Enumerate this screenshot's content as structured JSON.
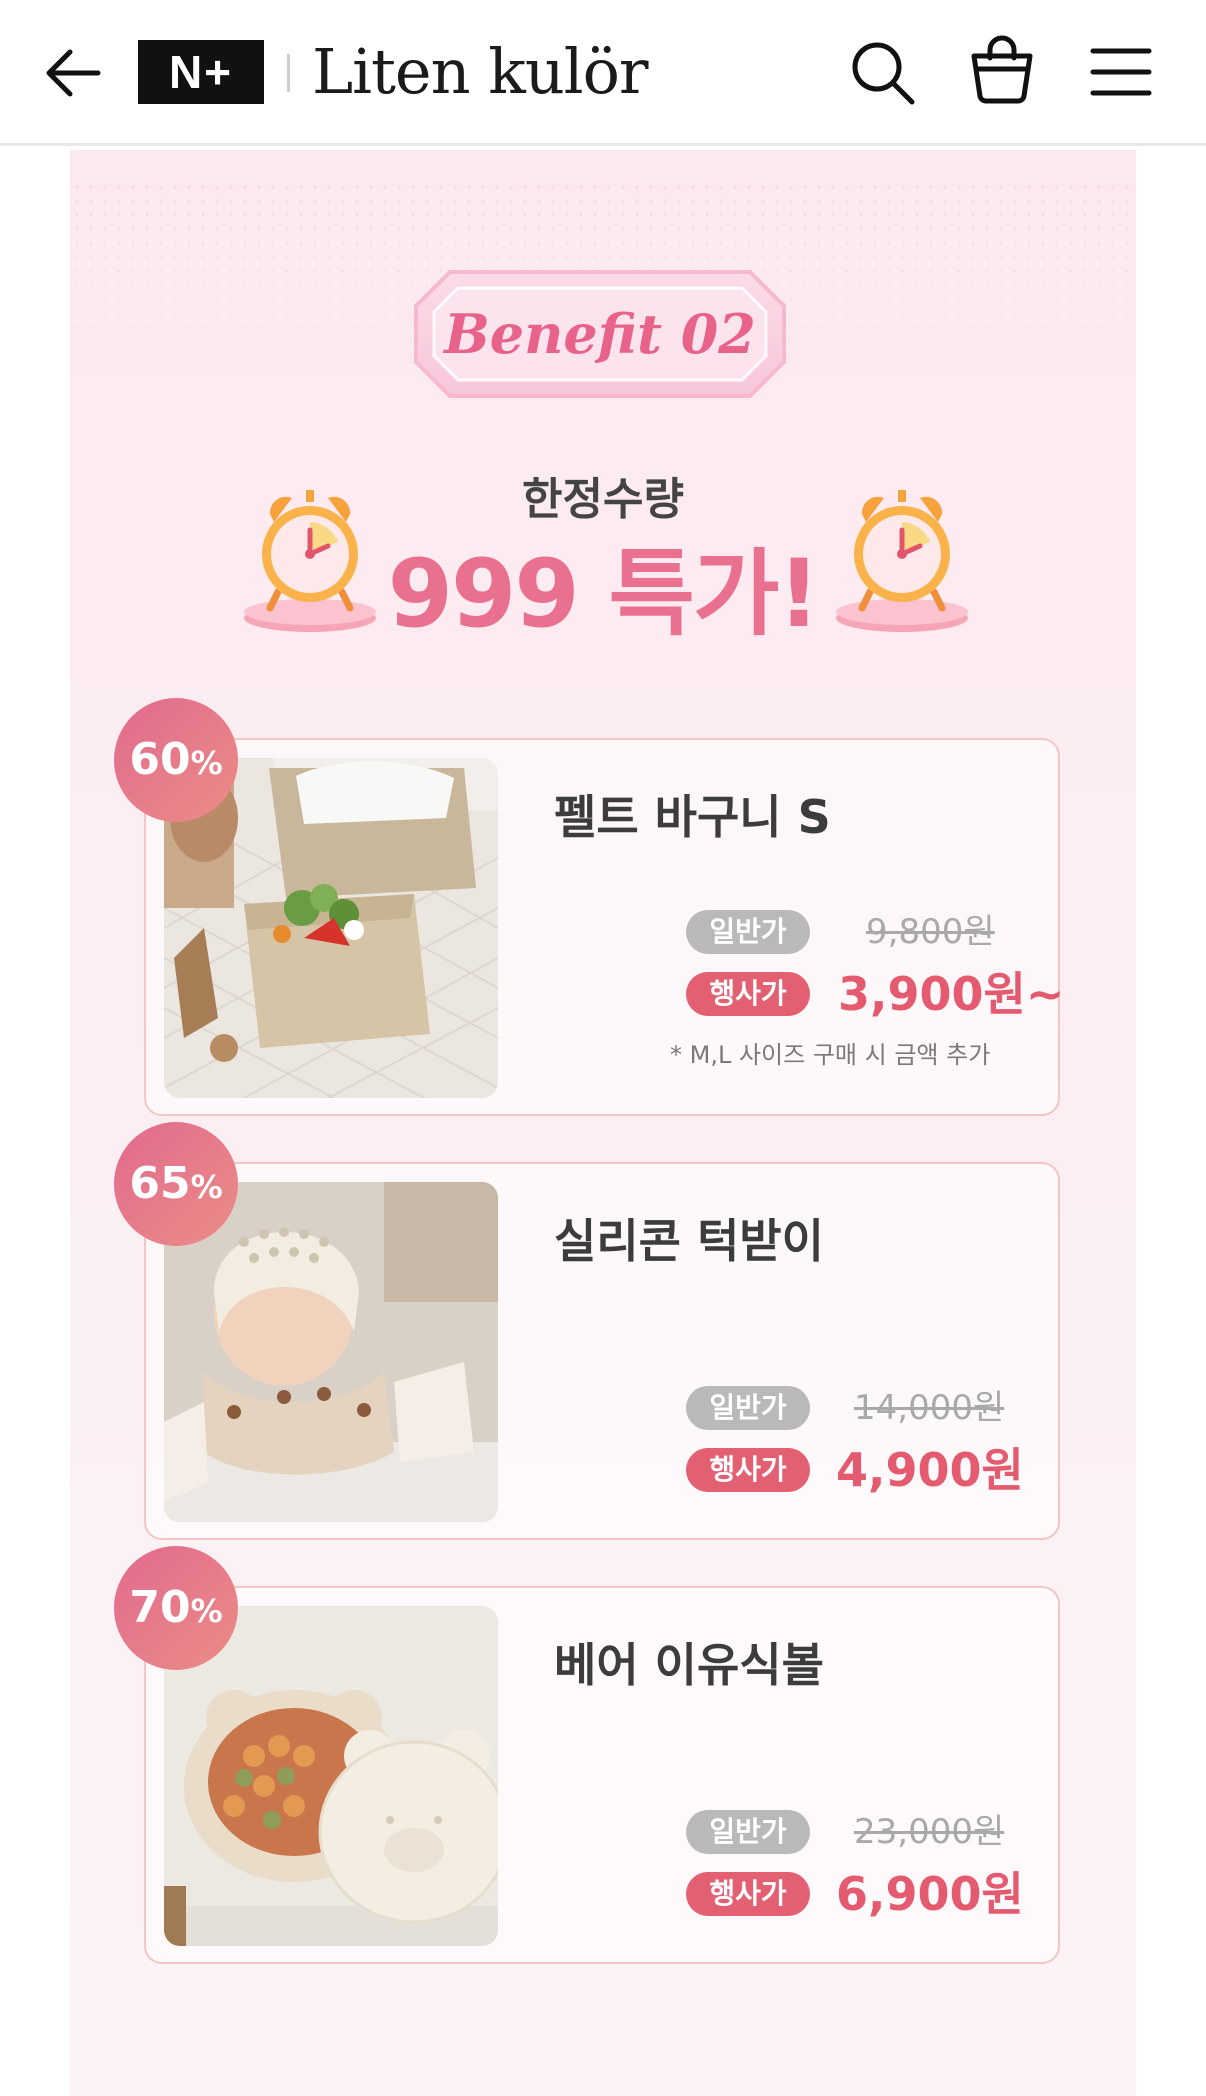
{
  "header": {
    "logo_mark": "N+",
    "brand": "Liten kulör",
    "icons": [
      "back-arrow-icon",
      "search-icon",
      "shopping-bag-icon",
      "menu-icon"
    ]
  },
  "promo": {
    "benefit_label": "Benefit 02",
    "limited_label": "한정수량",
    "headline": "999 특가!",
    "accent_color": "#e9718f",
    "sale_color": "#e45a6f"
  },
  "products": [
    {
      "discount": "60",
      "discount_unit": "%",
      "name": "펠트 바구니 S",
      "regular_tag": "일반가",
      "regular_price": "9,800원",
      "event_tag": "행사가",
      "event_price": "3,900원~",
      "note": "* M,L 사이즈 구매 시 금액 추가"
    },
    {
      "discount": "65",
      "discount_unit": "%",
      "name": "실리콘 턱받이",
      "regular_tag": "일반가",
      "regular_price": "14,000원",
      "event_tag": "행사가",
      "event_price": "4,900원"
    },
    {
      "discount": "70",
      "discount_unit": "%",
      "name": "베어 이유식볼",
      "regular_tag": "일반가",
      "regular_price": "23,000원",
      "event_tag": "행사가",
      "event_price": "6,900원"
    }
  ]
}
